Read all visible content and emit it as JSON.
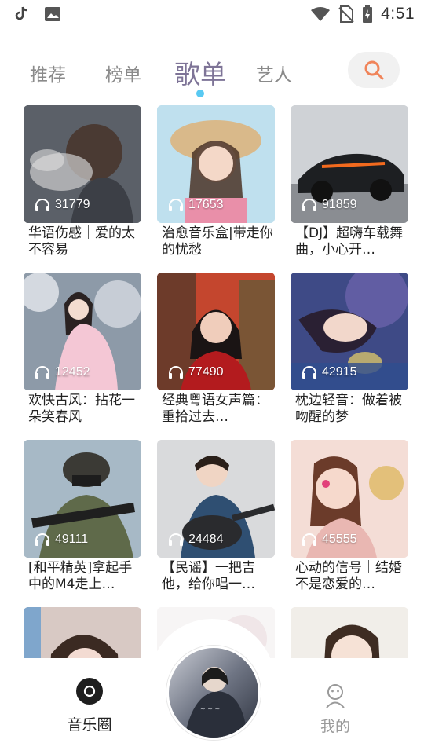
{
  "status_bar": {
    "time": "4:51",
    "icons": [
      "tiktok-icon",
      "image-icon",
      "wifi-icon",
      "no-sim-icon",
      "battery-charging-icon"
    ]
  },
  "tabs": [
    {
      "label": "推荐",
      "active": false
    },
    {
      "label": "榜单",
      "active": false
    },
    {
      "label": "歌单",
      "active": true
    },
    {
      "label": "艺人",
      "active": false
    }
  ],
  "accent": {
    "active_tab": "#7e7497",
    "indicator": "#59c9f2",
    "search": "#f0845a"
  },
  "playlists": [
    {
      "title": "华语伤感｜爱的太不容易",
      "plays": "31779",
      "thumb": "man-smoke"
    },
    {
      "title": "治愈音乐盒|带走你的忧愁",
      "plays": "17653",
      "thumb": "girl-straw-hat"
    },
    {
      "title": "【DJ】超嗨车载舞曲，小心开…",
      "plays": "91859",
      "thumb": "sports-car"
    },
    {
      "title": "欢快古风：拈花一朵笑春风",
      "plays": "12452",
      "thumb": "hanfu-girl"
    },
    {
      "title": "经典粤语女声篇：重拾过去…",
      "plays": "77490",
      "thumb": "retro-girl"
    },
    {
      "title": "枕边轻音：做着被吻醒的梦",
      "plays": "42915",
      "thumb": "sleeping-girl"
    },
    {
      "title": "[和平精英]拿起手中的M4走上…",
      "plays": "49111",
      "thumb": "soldier"
    },
    {
      "title": "【民谣】一把吉他，给你唱一…",
      "plays": "24484",
      "thumb": "guitar-boy"
    },
    {
      "title": "心动的信号｜结婚不是恋爱的…",
      "plays": "45555",
      "thumb": "smiling-woman"
    },
    {
      "title": "",
      "plays": "",
      "thumb": "girl-portrait"
    },
    {
      "title": "",
      "plays": "",
      "thumb": "white"
    },
    {
      "title": "",
      "plays": "",
      "thumb": "anime-girl"
    }
  ],
  "bottom_nav": {
    "left": {
      "label": "音乐圈",
      "icon": "vinyl-icon"
    },
    "right": {
      "label": "我的",
      "icon": "person-icon"
    }
  }
}
